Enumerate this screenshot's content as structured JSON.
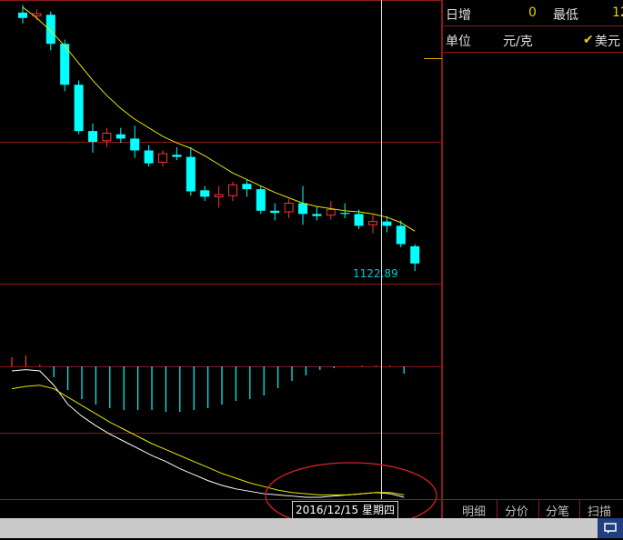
{
  "side_panel": {
    "rise_label": "日增",
    "rise_value": "0",
    "low_label": "最低",
    "low_value": "12",
    "unit_label": "单位",
    "unit_value": "元/克",
    "currency_check": "✔",
    "currency_label": "美元"
  },
  "tabs": [
    "明细",
    "分价",
    "分笔",
    "扫描"
  ],
  "cursor": {
    "date_label": "2016/12/15 星期四",
    "price_label": "1122.89"
  },
  "status_icon": "chat-icon",
  "colors": {
    "up": "#ff3333",
    "down": "#00ffff",
    "ma": "#e6e600",
    "grid": "#8b1a1a",
    "signal_line": "#e6e600",
    "macd_line": "#ffffff",
    "highlight_circle": "#d92020"
  },
  "chart_data": [
    {
      "type": "candlestick",
      "series_note": "price candles with moving average",
      "candles": [
        {
          "o": 1335,
          "c": 1330,
          "h": 1342,
          "l": 1325,
          "up": false
        },
        {
          "o": 1332,
          "c": 1334,
          "h": 1338,
          "l": 1328,
          "up": true
        },
        {
          "o": 1333,
          "c": 1306,
          "h": 1336,
          "l": 1300,
          "up": false
        },
        {
          "o": 1306,
          "c": 1268,
          "h": 1310,
          "l": 1262,
          "up": false
        },
        {
          "o": 1268,
          "c": 1225,
          "h": 1272,
          "l": 1222,
          "up": false
        },
        {
          "o": 1225,
          "c": 1215,
          "h": 1232,
          "l": 1205,
          "up": false
        },
        {
          "o": 1216,
          "c": 1223,
          "h": 1228,
          "l": 1210,
          "up": true
        },
        {
          "o": 1222,
          "c": 1218,
          "h": 1228,
          "l": 1214,
          "up": false
        },
        {
          "o": 1218,
          "c": 1207,
          "h": 1230,
          "l": 1200,
          "up": false
        },
        {
          "o": 1207,
          "c": 1195,
          "h": 1212,
          "l": 1192,
          "up": false
        },
        {
          "o": 1196,
          "c": 1204,
          "h": 1207,
          "l": 1192,
          "up": true
        },
        {
          "o": 1203,
          "c": 1201,
          "h": 1210,
          "l": 1198,
          "up": false
        },
        {
          "o": 1201,
          "c": 1169,
          "h": 1210,
          "l": 1165,
          "up": false
        },
        {
          "o": 1170,
          "c": 1164,
          "h": 1174,
          "l": 1160,
          "up": false
        },
        {
          "o": 1164,
          "c": 1166,
          "h": 1174,
          "l": 1154,
          "up": true
        },
        {
          "o": 1165,
          "c": 1175,
          "h": 1178,
          "l": 1160,
          "up": true
        },
        {
          "o": 1176,
          "c": 1171,
          "h": 1180,
          "l": 1164,
          "up": false
        },
        {
          "o": 1171,
          "c": 1151,
          "h": 1174,
          "l": 1148,
          "up": false
        },
        {
          "o": 1151,
          "c": 1149,
          "h": 1158,
          "l": 1142,
          "up": false
        },
        {
          "o": 1150,
          "c": 1158,
          "h": 1162,
          "l": 1144,
          "up": true
        },
        {
          "o": 1158,
          "c": 1148,
          "h": 1174,
          "l": 1138,
          "up": false
        },
        {
          "o": 1148,
          "c": 1146,
          "h": 1155,
          "l": 1142,
          "up": false
        },
        {
          "o": 1147,
          "c": 1152,
          "h": 1160,
          "l": 1143,
          "up": true
        },
        {
          "o": 1149,
          "c": 1148,
          "h": 1158,
          "l": 1144,
          "up": false
        },
        {
          "o": 1148,
          "c": 1137,
          "h": 1152,
          "l": 1134,
          "up": false
        },
        {
          "o": 1138,
          "c": 1141,
          "h": 1147,
          "l": 1130,
          "up": true
        },
        {
          "o": 1141,
          "c": 1137,
          "h": 1146,
          "l": 1131,
          "up": false
        },
        {
          "o": 1137,
          "c": 1120,
          "h": 1142,
          "l": 1117,
          "up": false
        },
        {
          "o": 1118,
          "c": 1102,
          "h": 1120,
          "l": 1095,
          "up": false
        }
      ],
      "ma": [
        1340,
        1330,
        1318,
        1304,
        1288,
        1272,
        1258,
        1246,
        1236,
        1228,
        1220,
        1214,
        1209,
        1202,
        1194,
        1186,
        1180,
        1174,
        1168,
        1163,
        1158,
        1155,
        1153,
        1151,
        1150,
        1148,
        1145,
        1140,
        1132
      ]
    },
    {
      "type": "macd",
      "histogram": [
        0.5,
        0.6,
        0.1,
        -0.6,
        -1.3,
        -1.8,
        -2.1,
        -2.3,
        -2.4,
        -2.4,
        -2.4,
        -2.5,
        -2.5,
        -2.4,
        -2.3,
        -2.1,
        -1.9,
        -1.8,
        -1.6,
        -1.2,
        -0.8,
        -0.5,
        -0.2,
        -0.1,
        0.03,
        0.05,
        0.05,
        0.05,
        -0.4
      ],
      "macd": [
        -0.4,
        -0.3,
        -0.4,
        -1.6,
        -3.2,
        -4.2,
        -5.0,
        -5.7,
        -6.3,
        -6.9,
        -7.5,
        -8.0,
        -8.6,
        -9.1,
        -9.6,
        -10.0,
        -10.3,
        -10.5,
        -10.7,
        -10.8,
        -10.9,
        -11.0,
        -11.0,
        -10.9,
        -10.8,
        -10.7,
        -10.6,
        -10.7,
        -11.0
      ],
      "signal": [
        -1.9,
        -1.7,
        -1.6,
        -1.9,
        -2.6,
        -3.3,
        -4.0,
        -4.7,
        -5.3,
        -5.9,
        -6.5,
        -7.0,
        -7.5,
        -8.0,
        -8.5,
        -9.0,
        -9.4,
        -9.8,
        -10.1,
        -10.4,
        -10.6,
        -10.7,
        -10.8,
        -10.8,
        -10.8,
        -10.7,
        -10.6,
        -10.6,
        -10.8
      ]
    }
  ]
}
